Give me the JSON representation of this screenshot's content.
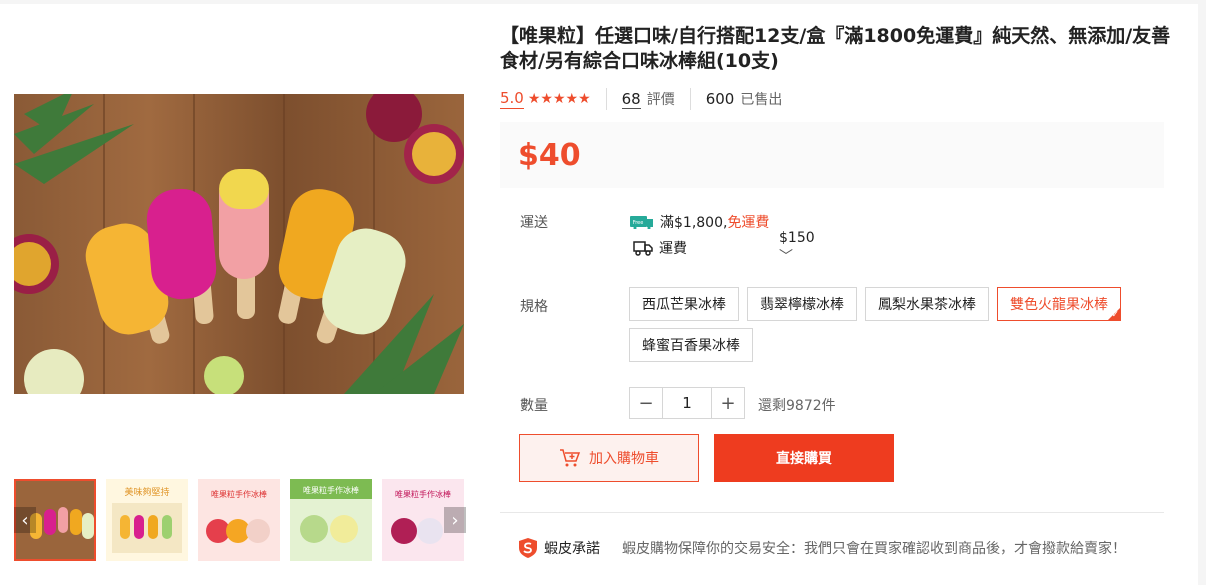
{
  "product": {
    "title": "【唯果粒】任選口味/自行搭配12支/盒『滿1800免運費』純天然、無添加/友善食材/另有綜合口味冰棒組(10支)",
    "rating": "5.0",
    "stars": "★★★★★",
    "reviews_count": "68",
    "reviews_label": "評價",
    "sold_count": "600",
    "sold_label": "已售出",
    "price": "$40"
  },
  "shipping": {
    "label": "運送",
    "free_threshold": "滿$1,800,",
    "free_text": "免運費",
    "fee_label": "運費",
    "fee_value": "$150",
    "chevron": "﹀"
  },
  "variants": {
    "label": "規格",
    "options": [
      "西瓜芒果冰棒",
      "翡翠檸檬冰棒",
      "鳳梨水果茶冰棒",
      "雙色火龍果冰棒",
      "蜂蜜百香果冰棒"
    ],
    "selected": "雙色火龍果冰棒"
  },
  "quantity": {
    "label": "數量",
    "minus": "−",
    "value": "1",
    "plus": "+",
    "stock": "還剩9872件"
  },
  "actions": {
    "add_to_cart": "加入購物車",
    "buy_now": "直接購買"
  },
  "guarantee": {
    "title": "蝦皮承諾",
    "text": "蝦皮購物保障你的交易安全：我們只會在買家確認收到商品後，才會撥款給賣家！"
  },
  "gallery": {
    "prev": "‹",
    "next": "›",
    "thumb_captions": [
      "",
      "美味夠堅持",
      "唯果粒手作冰棒",
      "唯果粒手作冰棒",
      "唯果粒手作冰棒"
    ]
  },
  "colors": {
    "accent": "#ee4d2d",
    "buy_button": "#ee3c1f"
  }
}
